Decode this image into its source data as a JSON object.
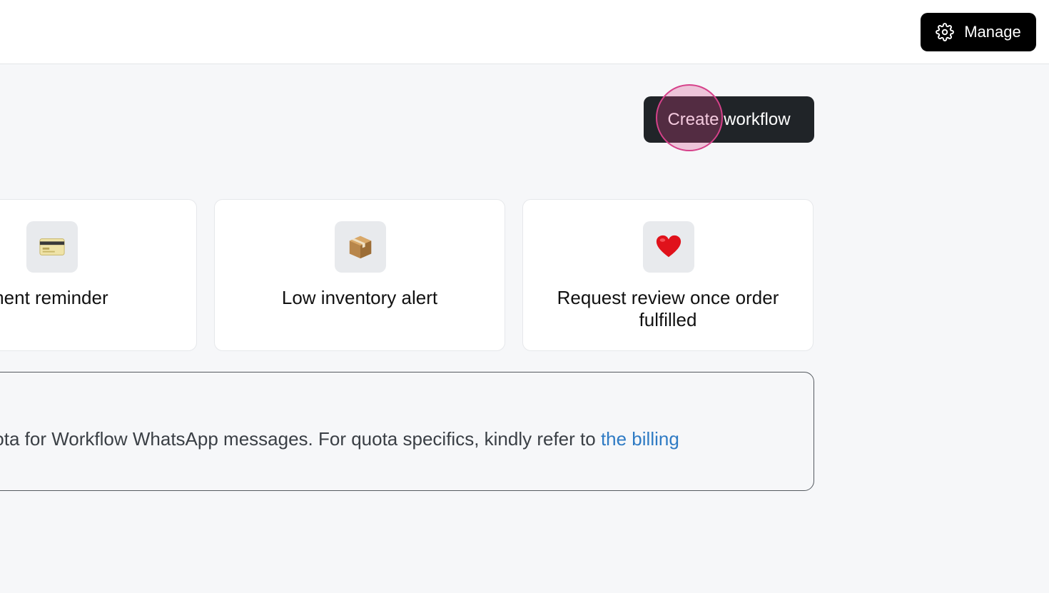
{
  "header": {
    "manage_label": "Manage",
    "manage_icon": "gear-icon"
  },
  "actions": {
    "create_workflow_label": "Create workflow"
  },
  "templates": [
    {
      "label": "yment reminder",
      "icon": "credit-card-icon"
    },
    {
      "label": "Low inventory alert",
      "icon": "package-icon"
    },
    {
      "label": "Request review once order fulfilled",
      "icon": "red-heart-icon"
    }
  ],
  "notice": {
    "text": "ted quota for Workflow WhatsApp messages. For quota specifics, kindly refer to ",
    "link_text": "the billing"
  },
  "colors": {
    "accent_link": "#2f7bc4",
    "button_dark": "#202428",
    "click_highlight": "#d6418a"
  }
}
